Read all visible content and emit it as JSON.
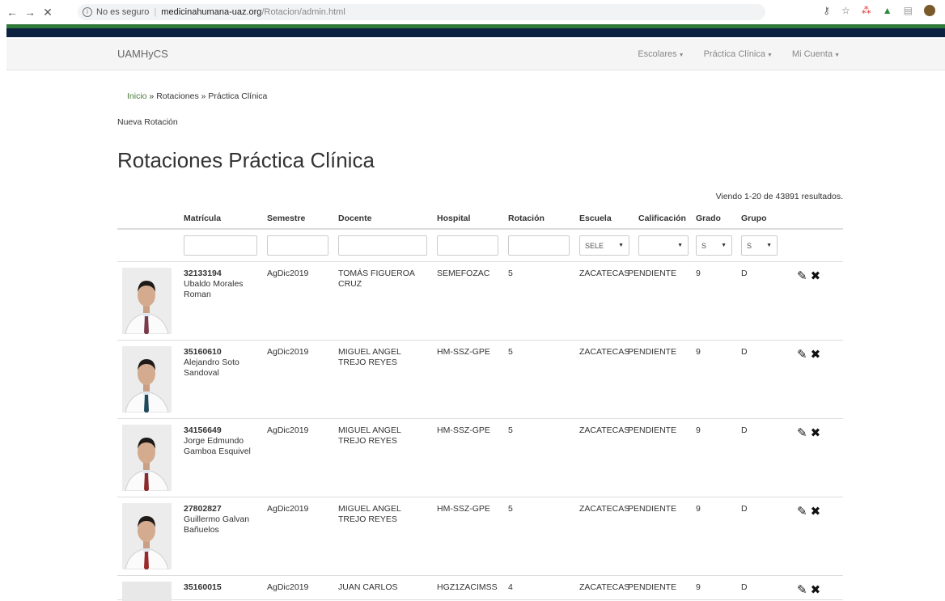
{
  "browser": {
    "back": "←",
    "forward": "→",
    "close": "✕",
    "security": "No es seguro",
    "host": "medicinahumana-uaz.org",
    "path": "/Rotacion/admin.html"
  },
  "navbar": {
    "brand": "UAMHyCS",
    "menu": [
      {
        "label": "Escolares"
      },
      {
        "label": "Práctica Clínica"
      },
      {
        "label": "Mi Cuenta"
      }
    ]
  },
  "breadcrumb": {
    "home": "Inicio",
    "sep": " » ",
    "rotaciones": "Rotaciones",
    "current": "Práctica Clínica"
  },
  "new_link": "Nueva Rotación",
  "page_title": "Rotaciones Práctica Clínica",
  "summary": "Viendo 1-20 de 43891 resultados.",
  "columns": [
    "Matrícula",
    "Semestre",
    "Docente",
    "Hospital",
    "Rotación",
    "Escuela",
    "Calificación",
    "Grado",
    "Grupo"
  ],
  "filters": {
    "escuela": "SELE",
    "grado": "S",
    "grupo": "S"
  },
  "rows": [
    {
      "matricula": "32133194",
      "nombre": "Ubaldo Morales Roman",
      "semestre": "AgDic2019",
      "docente": "TOMÁS FIGUEROA CRUZ",
      "hospital": "SEMEFOZAC",
      "rotacion": "5",
      "escuela": "ZACATECAS",
      "calificacion": "PENDIENTE",
      "grado": "9",
      "grupo": "D",
      "tie": "#7a3a4a"
    },
    {
      "matricula": "35160610",
      "nombre": "Alejandro Soto Sandoval",
      "semestre": "AgDic2019",
      "docente": "MIGUEL ANGEL TREJO REYES",
      "hospital": "HM-SSZ-GPE",
      "rotacion": "5",
      "escuela": "ZACATECAS",
      "calificacion": "PENDIENTE",
      "grado": "9",
      "grupo": "D",
      "tie": "#1f4a5a"
    },
    {
      "matricula": "34156649",
      "nombre": "Jorge Edmundo Gamboa Esquivel",
      "semestre": "AgDic2019",
      "docente": "MIGUEL ANGEL TREJO REYES",
      "hospital": "HM-SSZ-GPE",
      "rotacion": "5",
      "escuela": "ZACATECAS",
      "calificacion": "PENDIENTE",
      "grado": "9",
      "grupo": "D",
      "tie": "#8a2a2a"
    },
    {
      "matricula": "27802827",
      "nombre": "Guillermo Galvan Bañuelos",
      "semestre": "AgDic2019",
      "docente": "MIGUEL ANGEL TREJO REYES",
      "hospital": "HM-SSZ-GPE",
      "rotacion": "5",
      "escuela": "ZACATECAS",
      "calificacion": "PENDIENTE",
      "grado": "9",
      "grupo": "D",
      "tie": "#9a2a2a"
    }
  ],
  "partial_row": {
    "matricula": "35160015",
    "semestre": "AgDic2019",
    "docente": "JUAN CARLOS",
    "hospital": "HGZ1ZACIMSS",
    "rotacion": "4",
    "escuela": "ZACATECAS",
    "calificacion": "PENDIENTE",
    "grado": "9",
    "grupo": "D"
  },
  "icons": {
    "edit": "✎",
    "delete": "✖",
    "caret": "▼",
    "star": "☆",
    "key": "⚷"
  }
}
